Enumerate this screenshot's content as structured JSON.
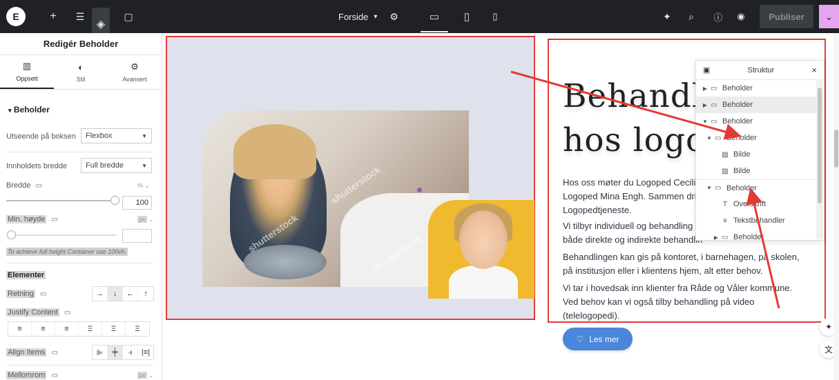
{
  "topbar": {
    "logo": "E",
    "page_name": "Forside",
    "publish": "Publiser"
  },
  "panel": {
    "title": "Redigér Beholder",
    "tabs": [
      {
        "label": "Oppsett"
      },
      {
        "label": "Stil"
      },
      {
        "label": "Avansert"
      }
    ],
    "section": "Beholder",
    "box_look_label": "Utseende på boksen",
    "box_look_value": "Flexbox",
    "content_width_label": "Innholdets bredde",
    "content_width_value": "Full bredde",
    "width_label": "Bredde",
    "width_unit": "%",
    "width_value": "100",
    "min_height_label": "Min. høyde",
    "min_height_unit": "px",
    "min_height_value": "",
    "hint": "To achieve full height Container use 100vh.",
    "elements_label": "Elementer",
    "direction_label": "Retning",
    "direction_buttons": [
      "→",
      "↓",
      "←",
      "↑"
    ],
    "justify_label": "Justify Content",
    "justify_buttons": [
      "≡",
      "≡",
      "≡",
      "Ξ",
      "Ξ",
      "Ξ"
    ],
    "align_label": "Align Items",
    "align_buttons": [
      "⊫",
      "╪",
      "⫣",
      "|≡|"
    ],
    "gap_label": "Mellomrom",
    "gap_unit": "px"
  },
  "canvas": {
    "heading_line1": "Behandli",
    "heading_line2": "hos logop",
    "p1": "Hos oss møter du Logoped Cecilie ",
    "p1b": "Logoped Mina Engh. Sammen drive",
    "p1c": "Logopedtjeneste.",
    "p2a": "Vi tilbyr individuell og behandling i ",
    "p2b": "både direkte og indirekte behandlin",
    "p3a": "Behandlingen kan gis på kontoret, i barnehagen, på skolen,",
    "p3b": "på institusjon eller i klientens hjem, alt etter behov.",
    "p4a": "Vi tar i hovedsak inn klienter fra Råde og Våler kommune.",
    "p4b": "Ved behov kan vi også tilby behandling på video",
    "p4c": "(telelogopedi).",
    "button": "Les mer",
    "watermark": "shutterstock"
  },
  "structure": {
    "title": "Struktur",
    "items": [
      {
        "label": "Beholder"
      },
      {
        "label": "Beholder"
      },
      {
        "label": "Beholder"
      },
      {
        "label": "Beholder"
      },
      {
        "label": "Bilde"
      },
      {
        "label": "Bilde"
      },
      {
        "label": "Beholder"
      },
      {
        "label": "Overskrift"
      },
      {
        "label": "Tekstbehandler"
      },
      {
        "label": "Beholder"
      }
    ]
  },
  "colors": {
    "topbar": "#1f2124",
    "accent": "#e7a5f0",
    "selection_border": "#e53935",
    "button": "#4a86d9"
  }
}
